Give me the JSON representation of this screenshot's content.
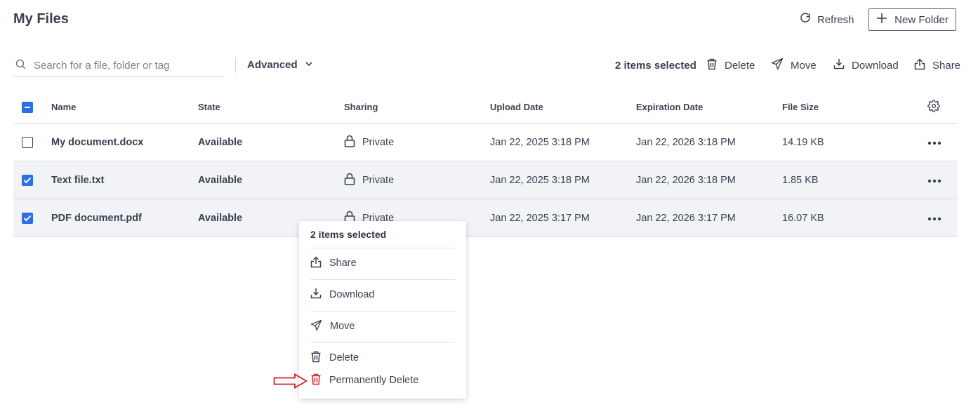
{
  "page": {
    "title": "My Files"
  },
  "header": {
    "refresh_label": "Refresh",
    "new_folder_label": "New Folder"
  },
  "search": {
    "placeholder": "Search for a file, folder or tag",
    "value": "",
    "advanced_label": "Advanced"
  },
  "toolbar": {
    "selected_count": "2 items selected",
    "delete_label": "Delete",
    "move_label": "Move",
    "download_label": "Download",
    "share_label": "Share"
  },
  "table": {
    "columns": [
      "Name",
      "State",
      "Sharing",
      "Upload Date",
      "Expiration Date",
      "File Size"
    ],
    "rows": [
      {
        "name": "My document.docx",
        "state": "Available",
        "sharing": "Private",
        "upload": "Jan 22, 2025 3:18 PM",
        "expiration": "Jan 22, 2026 3:18 PM",
        "size": "14.19 KB",
        "selected": false
      },
      {
        "name": "Text file.txt",
        "state": "Available",
        "sharing": "Private",
        "upload": "Jan 22, 2025 3:18 PM",
        "expiration": "Jan 22, 2026 3:18 PM",
        "size": "1.85 KB",
        "selected": true
      },
      {
        "name": "PDF document.pdf",
        "state": "Available",
        "sharing": "Private",
        "upload": "Jan 22, 2025 3:17 PM",
        "expiration": "Jan 22, 2026 3:17 PM",
        "size": "16.07 KB",
        "selected": true
      }
    ]
  },
  "context_menu": {
    "title": "2 items selected",
    "share": "Share",
    "download": "Download",
    "move": "Move",
    "delete": "Delete",
    "permanently_delete": "Permanently Delete"
  },
  "colors": {
    "accent": "#2d6ee0",
    "danger": "#d0242b",
    "text": "#3b4150",
    "selected_row": "#f1f3f7"
  },
  "icons": [
    "refresh-icon",
    "plus-icon",
    "search-icon",
    "chevron-down-icon",
    "trash-icon",
    "send-icon",
    "download-icon",
    "share-icon",
    "lock-icon",
    "gear-icon",
    "more-icon",
    "arrow-right-icon"
  ]
}
